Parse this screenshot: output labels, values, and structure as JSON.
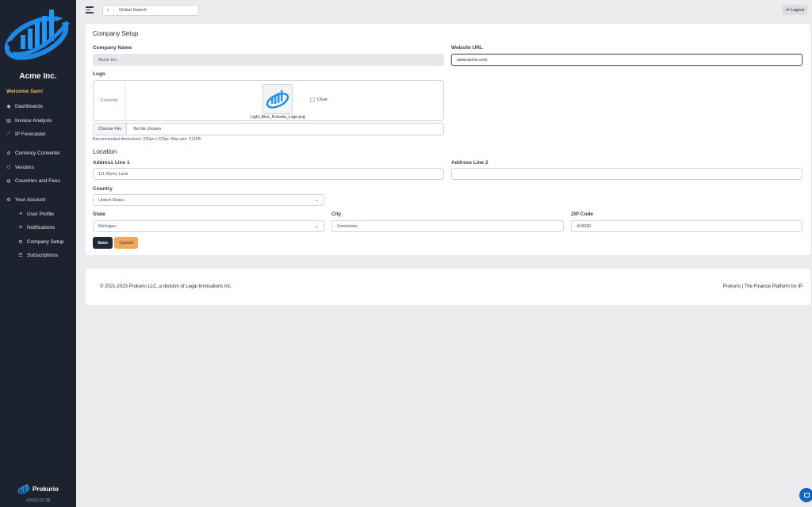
{
  "colors": {
    "sidebar": "#1d232e",
    "accent": "#f4b35e",
    "brand_blue": "#1e88e5",
    "save": "#1f2937",
    "cancel": "#f0a95a"
  },
  "sidebar": {
    "company": "Acme Inc.",
    "welcome": "Welcome Sam!",
    "nav": [
      {
        "label": "Dashboards",
        "icon": "palette-icon"
      },
      {
        "label": "Invoice Analysis",
        "icon": "invoice-icon"
      },
      {
        "label": "IP Forecaster",
        "icon": "chart-line-icon"
      },
      {
        "label": "Currency Converter",
        "icon": "coins-icon"
      },
      {
        "label": "Vendors",
        "icon": "users-icon"
      },
      {
        "label": "Countries and Fees",
        "icon": "globe-icon"
      },
      {
        "label": "Your Account",
        "icon": "gear-icon"
      }
    ],
    "account_sub": [
      {
        "label": "User Profile",
        "icon": "user-circle-icon"
      },
      {
        "label": "Notifications",
        "icon": "bell-icon"
      },
      {
        "label": "Company Setup",
        "icon": "gear-icon"
      },
      {
        "label": "Subscriptions",
        "icon": "list-icon"
      }
    ],
    "brand": "Prokurio",
    "version": "v2023.02.28"
  },
  "topbar": {
    "search_placeholder": "Global Search",
    "logout": "Logout"
  },
  "form": {
    "title": "Company Setup",
    "company_name_label": "Company Name",
    "company_name_value": "Acme Inc.",
    "website_label": "Website URL",
    "website_value": "www.acme.com",
    "logo_label": "Logo",
    "currently": "Currently",
    "logo_filename": "Light_Blue_Prokurio_Logo.png",
    "clear_label": "Clear",
    "choose_file": "Choose File",
    "no_file": "No file chosen",
    "hint": "Recommended dimensions: 220px x 220px. Max size: 512KB",
    "location_title": "Location",
    "address1_label": "Address Line 1",
    "address1_value": "111 Merry Lane",
    "address2_label": "Address Line 2",
    "address2_value": "",
    "country_label": "Country",
    "country_value": "United States",
    "state_label": "State",
    "state_value": "Michigan",
    "city_label": "City",
    "city_value": "Sometown",
    "zip_label": "ZIP Code",
    "zip_value": "418080",
    "save": "Save",
    "cancel": "Cancel"
  },
  "footer": {
    "left": "© 2021-2023 Prokurio LLC, a division of Legal Innovations Inc.",
    "right": "Prokurio | The Finance Platform for IP"
  }
}
